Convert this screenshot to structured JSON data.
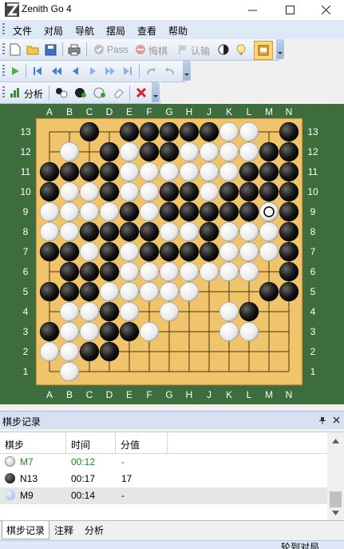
{
  "app": {
    "title": "Zenith Go 4"
  },
  "menu": {
    "items": [
      "文件",
      "对局",
      "导航",
      "摆局",
      "查看",
      "帮助"
    ]
  },
  "toolbar1": {
    "pass_label": "Pass",
    "undo_label": "悔棋",
    "resign_label": "认输"
  },
  "toolbar3": {
    "analysis_label": "分析"
  },
  "board": {
    "columns": [
      "A",
      "B",
      "C",
      "D",
      "E",
      "F",
      "G",
      "H",
      "J",
      "K",
      "L",
      "M",
      "N"
    ],
    "rows": [
      "13",
      "12",
      "11",
      "10",
      "9",
      "8",
      "7",
      "6",
      "5",
      "4",
      "3",
      "2",
      "1"
    ],
    "stones": [
      [
        "..x.xxxxxoo.x"
      ],
      [
        ".o.xoxxooooxx"
      ],
      [
        "xxxxooooooxxx"
      ],
      [
        "xooxooxxoxxxx"
      ],
      [
        "ooooxoxxxxxxx"
      ],
      [
        "ooxxxxooxooox"
      ],
      [
        "xxoxoxxxxooox"
      ],
      [
        ".xxxooooooo.x"
      ],
      [
        "xxxooooo...xx"
      ],
      [
        ".ooxo.o..ox.."
      ],
      [
        "xooxxo...oo.."
      ],
      [
        "ooxx........."
      ],
      [
        ".o..........."
      ]
    ],
    "last_move": "M9",
    "stone_colors": {
      "black": "#111111",
      "white": "#ffffff",
      "board": "#f0c46a",
      "frame": "#3c6b3c"
    }
  },
  "panel": {
    "title": "棋步记录"
  },
  "moves_table": {
    "headers": [
      "棋步",
      "时间",
      "分值"
    ],
    "rows": [
      {
        "stone": "white",
        "move": "M7",
        "time": "00:12",
        "score": "-",
        "highlight": "green"
      },
      {
        "stone": "black",
        "move": "N13",
        "time": "00:17",
        "score": "17",
        "highlight": "none"
      },
      {
        "stone": "blue",
        "move": "M9",
        "time": "00:14",
        "score": "-",
        "highlight": "selected"
      }
    ]
  },
  "bottom_tabs": [
    "棋步记录",
    "注释",
    "分析"
  ],
  "status": {
    "text": "轮到对局"
  }
}
